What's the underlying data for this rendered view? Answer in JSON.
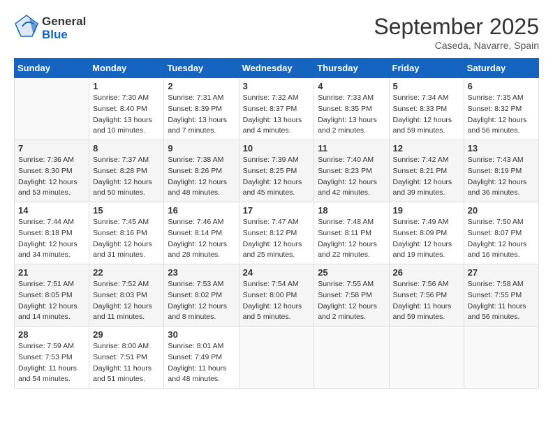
{
  "logo": {
    "text_general": "General",
    "text_blue": "Blue"
  },
  "title": "September 2025",
  "location": "Caseda, Navarre, Spain",
  "days_of_week": [
    "Sunday",
    "Monday",
    "Tuesday",
    "Wednesday",
    "Thursday",
    "Friday",
    "Saturday"
  ],
  "weeks": [
    [
      {
        "day": "",
        "info": ""
      },
      {
        "day": "1",
        "info": "Sunrise: 7:30 AM\nSunset: 8:40 PM\nDaylight: 13 hours\nand 10 minutes."
      },
      {
        "day": "2",
        "info": "Sunrise: 7:31 AM\nSunset: 8:39 PM\nDaylight: 13 hours\nand 7 minutes."
      },
      {
        "day": "3",
        "info": "Sunrise: 7:32 AM\nSunset: 8:37 PM\nDaylight: 13 hours\nand 4 minutes."
      },
      {
        "day": "4",
        "info": "Sunrise: 7:33 AM\nSunset: 8:35 PM\nDaylight: 13 hours\nand 2 minutes."
      },
      {
        "day": "5",
        "info": "Sunrise: 7:34 AM\nSunset: 8:33 PM\nDaylight: 12 hours\nand 59 minutes."
      },
      {
        "day": "6",
        "info": "Sunrise: 7:35 AM\nSunset: 8:32 PM\nDaylight: 12 hours\nand 56 minutes."
      }
    ],
    [
      {
        "day": "7",
        "info": "Sunrise: 7:36 AM\nSunset: 8:30 PM\nDaylight: 12 hours\nand 53 minutes."
      },
      {
        "day": "8",
        "info": "Sunrise: 7:37 AM\nSunset: 8:28 PM\nDaylight: 12 hours\nand 50 minutes."
      },
      {
        "day": "9",
        "info": "Sunrise: 7:38 AM\nSunset: 8:26 PM\nDaylight: 12 hours\nand 48 minutes."
      },
      {
        "day": "10",
        "info": "Sunrise: 7:39 AM\nSunset: 8:25 PM\nDaylight: 12 hours\nand 45 minutes."
      },
      {
        "day": "11",
        "info": "Sunrise: 7:40 AM\nSunset: 8:23 PM\nDaylight: 12 hours\nand 42 minutes."
      },
      {
        "day": "12",
        "info": "Sunrise: 7:42 AM\nSunset: 8:21 PM\nDaylight: 12 hours\nand 39 minutes."
      },
      {
        "day": "13",
        "info": "Sunrise: 7:43 AM\nSunset: 8:19 PM\nDaylight: 12 hours\nand 36 minutes."
      }
    ],
    [
      {
        "day": "14",
        "info": "Sunrise: 7:44 AM\nSunset: 8:18 PM\nDaylight: 12 hours\nand 34 minutes."
      },
      {
        "day": "15",
        "info": "Sunrise: 7:45 AM\nSunset: 8:16 PM\nDaylight: 12 hours\nand 31 minutes."
      },
      {
        "day": "16",
        "info": "Sunrise: 7:46 AM\nSunset: 8:14 PM\nDaylight: 12 hours\nand 28 minutes."
      },
      {
        "day": "17",
        "info": "Sunrise: 7:47 AM\nSunset: 8:12 PM\nDaylight: 12 hours\nand 25 minutes."
      },
      {
        "day": "18",
        "info": "Sunrise: 7:48 AM\nSunset: 8:11 PM\nDaylight: 12 hours\nand 22 minutes."
      },
      {
        "day": "19",
        "info": "Sunrise: 7:49 AM\nSunset: 8:09 PM\nDaylight: 12 hours\nand 19 minutes."
      },
      {
        "day": "20",
        "info": "Sunrise: 7:50 AM\nSunset: 8:07 PM\nDaylight: 12 hours\nand 16 minutes."
      }
    ],
    [
      {
        "day": "21",
        "info": "Sunrise: 7:51 AM\nSunset: 8:05 PM\nDaylight: 12 hours\nand 14 minutes."
      },
      {
        "day": "22",
        "info": "Sunrise: 7:52 AM\nSunset: 8:03 PM\nDaylight: 12 hours\nand 11 minutes."
      },
      {
        "day": "23",
        "info": "Sunrise: 7:53 AM\nSunset: 8:02 PM\nDaylight: 12 hours\nand 8 minutes."
      },
      {
        "day": "24",
        "info": "Sunrise: 7:54 AM\nSunset: 8:00 PM\nDaylight: 12 hours\nand 5 minutes."
      },
      {
        "day": "25",
        "info": "Sunrise: 7:55 AM\nSunset: 7:58 PM\nDaylight: 12 hours\nand 2 minutes."
      },
      {
        "day": "26",
        "info": "Sunrise: 7:56 AM\nSunset: 7:56 PM\nDaylight: 11 hours\nand 59 minutes."
      },
      {
        "day": "27",
        "info": "Sunrise: 7:58 AM\nSunset: 7:55 PM\nDaylight: 11 hours\nand 56 minutes."
      }
    ],
    [
      {
        "day": "28",
        "info": "Sunrise: 7:59 AM\nSunset: 7:53 PM\nDaylight: 11 hours\nand 54 minutes."
      },
      {
        "day": "29",
        "info": "Sunrise: 8:00 AM\nSunset: 7:51 PM\nDaylight: 11 hours\nand 51 minutes."
      },
      {
        "day": "30",
        "info": "Sunrise: 8:01 AM\nSunset: 7:49 PM\nDaylight: 11 hours\nand 48 minutes."
      },
      {
        "day": "",
        "info": ""
      },
      {
        "day": "",
        "info": ""
      },
      {
        "day": "",
        "info": ""
      },
      {
        "day": "",
        "info": ""
      }
    ]
  ]
}
